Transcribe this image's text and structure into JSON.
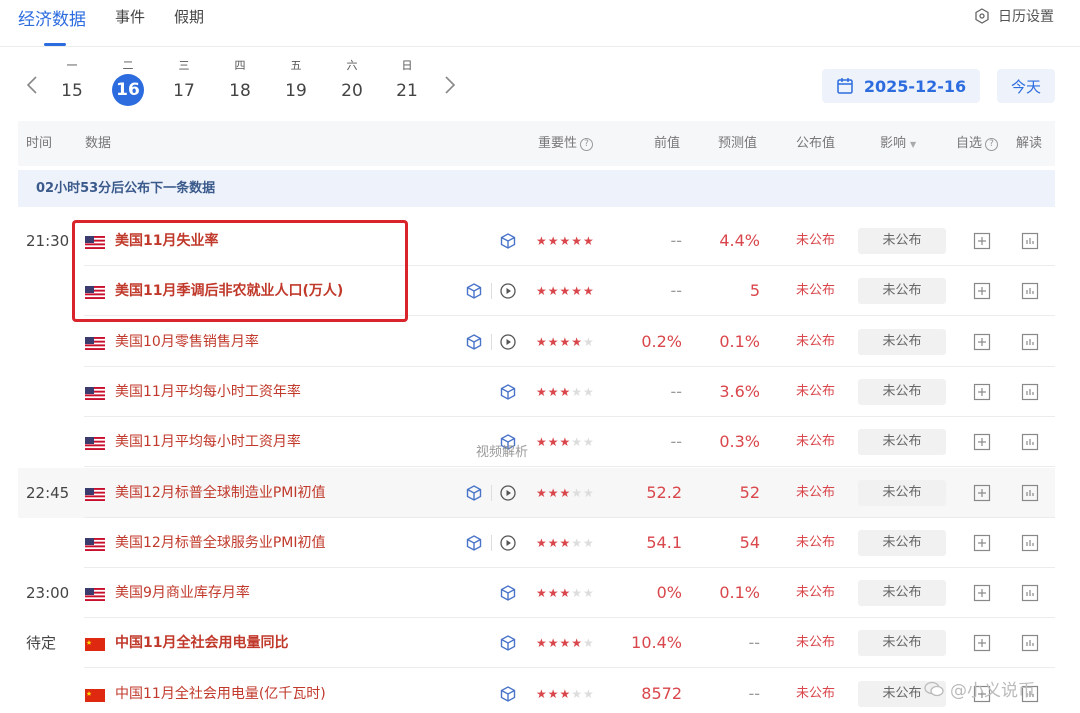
{
  "tabs": [
    {
      "label": "经济数据",
      "active": true
    },
    {
      "label": "事件",
      "active": false
    },
    {
      "label": "假期",
      "active": false
    }
  ],
  "calendar_settings_label": "日历设置",
  "week": [
    {
      "weekday": "一",
      "day": "15",
      "selected": false
    },
    {
      "weekday": "二",
      "day": "16",
      "selected": true
    },
    {
      "weekday": "三",
      "day": "17",
      "selected": false
    },
    {
      "weekday": "四",
      "day": "18",
      "selected": false
    },
    {
      "weekday": "五",
      "day": "19",
      "selected": false
    },
    {
      "weekday": "六",
      "day": "20",
      "selected": false
    },
    {
      "weekday": "日",
      "day": "21",
      "selected": false
    }
  ],
  "date_picker": "2025-12-16",
  "today_label": "今天",
  "columns": {
    "time": "时间",
    "data": "数据",
    "importance": "重要性",
    "previous": "前值",
    "forecast": "预测值",
    "actual": "公布值",
    "impact": "影响",
    "watchlist": "自选",
    "analysis": "解读"
  },
  "banner": "02小时53分后公布下一条数据",
  "rows": [
    {
      "time": "21:30",
      "flag": "us",
      "name": "美国11月失业率",
      "bold": true,
      "video": false,
      "stars": 5,
      "previous": "--",
      "forecast": "4.4%",
      "actual": "未公布",
      "impact": "未公布"
    },
    {
      "time": "",
      "flag": "us",
      "name": "美国11月季调后非农就业人口(万人)",
      "bold": true,
      "video": true,
      "stars": 5,
      "previous": "--",
      "forecast": "5",
      "actual": "未公布",
      "impact": "未公布"
    },
    {
      "time": "",
      "flag": "us",
      "name": "美国10月零售销售月率",
      "bold": false,
      "video": true,
      "stars": 4,
      "previous": "0.2%",
      "forecast": "0.1%",
      "actual": "未公布",
      "impact": "未公布"
    },
    {
      "time": "",
      "flag": "us",
      "name": "美国11月平均每小时工资年率",
      "bold": false,
      "video": false,
      "stars": 3,
      "previous": "--",
      "forecast": "3.6%",
      "actual": "未公布",
      "impact": "未公布"
    },
    {
      "time": "",
      "flag": "us",
      "name": "美国11月平均每小时工资月率",
      "bold": false,
      "video": false,
      "stars": 3,
      "previous": "--",
      "forecast": "0.3%",
      "actual": "未公布",
      "impact": "未公布"
    },
    {
      "time": "22:45",
      "flag": "us",
      "name": "美国12月标普全球制造业PMI初值",
      "bold": false,
      "video": true,
      "stars": 3,
      "previous": "52.2",
      "forecast": "52",
      "actual": "未公布",
      "impact": "未公布"
    },
    {
      "time": "",
      "flag": "us",
      "name": "美国12月标普全球服务业PMI初值",
      "bold": false,
      "video": true,
      "stars": 3,
      "previous": "54.1",
      "forecast": "54",
      "actual": "未公布",
      "impact": "未公布"
    },
    {
      "time": "23:00",
      "flag": "us",
      "name": "美国9月商业库存月率",
      "bold": false,
      "video": false,
      "stars": 3,
      "previous": "0%",
      "forecast": "0.1%",
      "actual": "未公布",
      "impact": "未公布"
    },
    {
      "time": "待定",
      "flag": "cn",
      "name": "中国11月全社会用电量同比",
      "bold": true,
      "video": false,
      "stars": 4,
      "previous": "10.4%",
      "forecast": "--",
      "actual": "未公布",
      "impact": "未公布"
    },
    {
      "time": "",
      "flag": "cn",
      "name": "中国11月全社会用电量(亿千瓦时)",
      "bold": false,
      "video": false,
      "stars": 3,
      "previous": "8572",
      "forecast": "--",
      "actual": "未公布",
      "impact": "未公布"
    }
  ],
  "tooltip": "视频解析",
  "watermark": "@小义说币",
  "colors": {
    "accent": "#2d6cdf",
    "red": "#d9464b",
    "highlight": "#d8242a"
  }
}
